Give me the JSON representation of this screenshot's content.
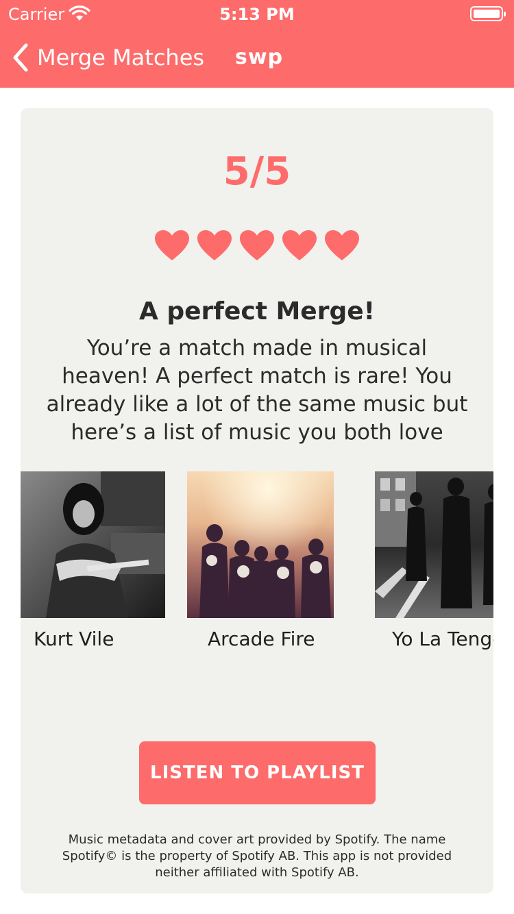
{
  "status_bar": {
    "carrier": "Carrier",
    "time": "5:13 PM"
  },
  "nav": {
    "back_label": "Merge Matches",
    "title": "swp"
  },
  "result": {
    "score": "5/5",
    "hearts_filled": 5,
    "hearts_total": 5,
    "headline": "A perfect Merge!",
    "description": "You’re a match made in musical heaven! A perfect match is rare! You already like a lot of the same music but here’s a list of music you both love"
  },
  "artists": [
    {
      "name": "Kurt Vile"
    },
    {
      "name": "Arcade Fire"
    },
    {
      "name": "Yo La Tengo"
    }
  ],
  "cta": {
    "label": "LISTEN TO PLAYLIST"
  },
  "footer": {
    "text": "Music metadata and cover art provided by Spotify. The name Spotify© is the property of Spotify AB. This app is not provided neither affiliated with Spotify AB."
  },
  "colors": {
    "accent": "#fd6b6b",
    "card_background": "#f1f1ee",
    "text": "#2b2b2b"
  },
  "icons": [
    "wifi-icon",
    "battery-icon",
    "back-chevron-icon",
    "heart-icon"
  ]
}
